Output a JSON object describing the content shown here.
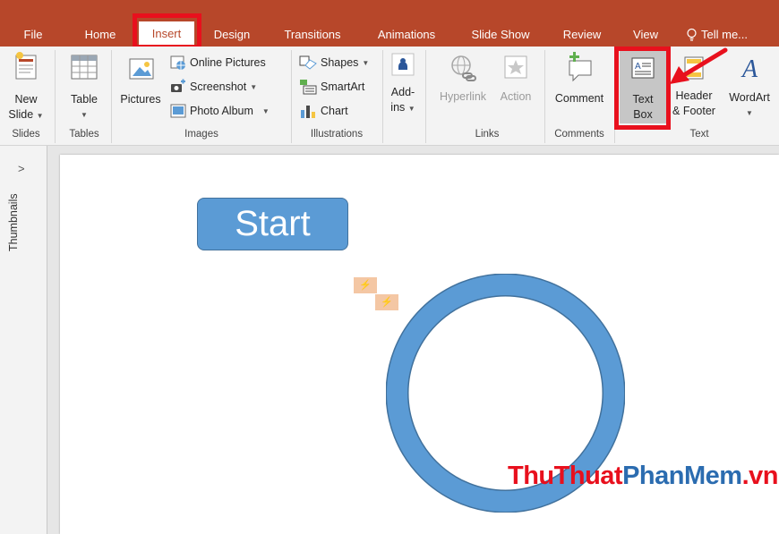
{
  "tabs": {
    "file": "File",
    "home": "Home",
    "insert": "Insert",
    "design": "Design",
    "transitions": "Transitions",
    "animations": "Animations",
    "slide_show": "Slide Show",
    "review": "Review",
    "view": "View",
    "tell_me": "Tell me..."
  },
  "ribbon": {
    "slides": {
      "new_slide_line1": "New",
      "new_slide_line2": "Slide",
      "label": "Slides"
    },
    "tables": {
      "table": "Table",
      "label": "Tables"
    },
    "images": {
      "pictures": "Pictures",
      "online_pictures": "Online Pictures",
      "screenshot": "Screenshot",
      "photo_album": "Photo Album",
      "label": "Images"
    },
    "illustrations": {
      "shapes": "Shapes",
      "smartart": "SmartArt",
      "chart": "Chart",
      "label": "Illustrations"
    },
    "addins": {
      "line1": "Add-",
      "line2": "ins"
    },
    "links": {
      "hyperlink": "Hyperlink",
      "action": "Action",
      "label": "Links"
    },
    "comments": {
      "comment": "Comment",
      "label": "Comments"
    },
    "text": {
      "text_box_line1": "Text",
      "text_box_line2": "Box",
      "header_line1": "Header",
      "header_line2": "& Footer",
      "wordart": "WordArt",
      "label": "Text"
    }
  },
  "left_pane": {
    "collapse": ">",
    "thumbnails": "Thumbnails"
  },
  "slide": {
    "start_shape_text": "Start",
    "watermark": {
      "part1": "Thu",
      "part2": "Thuat",
      "part3": "PhanMem",
      "part4": ".vn"
    }
  },
  "colors": {
    "accent": "#b7472a",
    "highlight": "#e8101d",
    "shape_fill": "#5b9bd5",
    "shape_border": "#41719c"
  }
}
